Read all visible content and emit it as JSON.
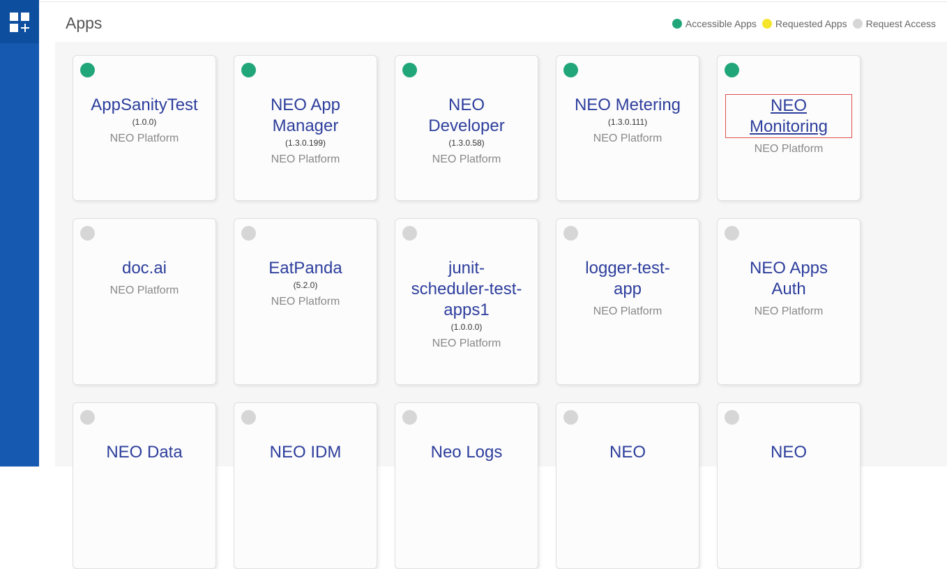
{
  "header": {
    "title": "Apps"
  },
  "legend": [
    {
      "label": "Accessible Apps",
      "color": "#21a67a"
    },
    {
      "label": "Requested Apps",
      "color": "#f5e52b"
    },
    {
      "label": "Request Access",
      "color": "#d6d6d6"
    }
  ],
  "icons": {
    "sidebar_logo": "app-grid-add-icon"
  },
  "apps": [
    {
      "name": "AppSanityTest",
      "version": "(1.0.0)",
      "platform": "NEO Platform",
      "status": "accessible"
    },
    {
      "name": "NEO App Manager",
      "version": "(1.3.0.199)",
      "platform": "NEO Platform",
      "status": "accessible"
    },
    {
      "name": "NEO Developer",
      "version": "(1.3.0.58)",
      "platform": "NEO Platform",
      "status": "accessible"
    },
    {
      "name": "NEO Metering",
      "version": "(1.3.0.111)",
      "platform": "NEO Platform",
      "status": "accessible"
    },
    {
      "name": "NEO Monitoring",
      "version": "",
      "platform": "NEO Platform",
      "status": "accessible",
      "focused": true
    },
    {
      "name": "doc.ai",
      "version": "",
      "platform": "NEO Platform",
      "status": "request"
    },
    {
      "name": "EatPanda",
      "version": "(5.2.0)",
      "platform": "NEO Platform",
      "status": "request"
    },
    {
      "name": "junit-scheduler-test-apps1",
      "version": "(1.0.0.0)",
      "platform": "NEO Platform",
      "status": "request"
    },
    {
      "name": "logger-test-app",
      "version": "",
      "platform": "NEO Platform",
      "status": "request"
    },
    {
      "name": "NEO Apps Auth",
      "version": "",
      "platform": "NEO Platform",
      "status": "request"
    },
    {
      "name": "NEO Data",
      "version": "",
      "platform": "",
      "status": "request"
    },
    {
      "name": "NEO IDM",
      "version": "",
      "platform": "",
      "status": "request"
    },
    {
      "name": "Neo Logs",
      "version": "",
      "platform": "",
      "status": "request"
    },
    {
      "name": "NEO",
      "version": "",
      "platform": "",
      "status": "request"
    },
    {
      "name": "NEO",
      "version": "",
      "platform": "",
      "status": "request"
    }
  ],
  "status_colors": {
    "accessible": "#21a67a",
    "requested": "#f5e52b",
    "request": "#d6d6d6"
  }
}
